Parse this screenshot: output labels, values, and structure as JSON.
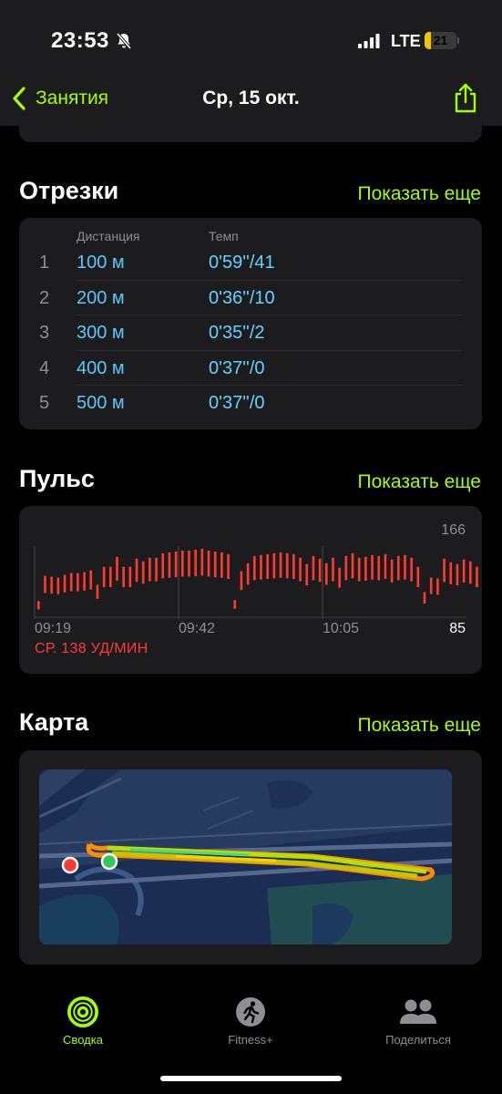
{
  "status": {
    "time": "23:53",
    "network": "LTE",
    "battery": "21",
    "battery_level": 0.21,
    "battery_color": "#f5c400"
  },
  "nav": {
    "back_label": "Занятия",
    "title": "Ср, 15 окт."
  },
  "splits": {
    "title": "Отрезки",
    "more": "Показать еще",
    "col_distance": "Дистанция",
    "col_pace": "Темп",
    "rows": [
      {
        "idx": "1",
        "distance": "100 м",
        "pace": "0'59''/41"
      },
      {
        "idx": "2",
        "distance": "200 м",
        "pace": "0'36''/10"
      },
      {
        "idx": "3",
        "distance": "300 м",
        "pace": "0'35''/2"
      },
      {
        "idx": "4",
        "distance": "400 м",
        "pace": "0'37''/0"
      },
      {
        "idx": "5",
        "distance": "500 м",
        "pace": "0'37''/0"
      }
    ]
  },
  "heart": {
    "title": "Пульс",
    "more": "Показать еще",
    "max": "166",
    "min": "85",
    "times": [
      "09:19",
      "09:42",
      "10:05"
    ],
    "avg": "СР. 138 УД/МИН",
    "color": "#ff3b30"
  },
  "chart_data": {
    "type": "bar",
    "ylim": [
      85,
      166
    ],
    "x_ticks": [
      "09:19",
      "09:42",
      "10:05"
    ],
    "bars_per_tick": 22,
    "series": [
      {
        "values": [
          103,
          131,
          130,
          129,
          132,
          134,
          134,
          135,
          137,
          121,
          141,
          141,
          152,
          141,
          141,
          150,
          147,
          151,
          151,
          156,
          157,
          158,
          159,
          159,
          160,
          161,
          159,
          158,
          157,
          155,
          104,
          136,
          145,
          153,
          154,
          155,
          156,
          157,
          156,
          155,
          151,
          144,
          153,
          150,
          145,
          151,
          140,
          153,
          156,
          151,
          152,
          154,
          153,
          155,
          149,
          153,
          154,
          151,
          141,
          113,
          129,
          128,
          150,
          146,
          144,
          149,
          147,
          141,
          148,
          140,
          140,
          134,
          116,
          107,
          104,
          103,
          103,
          102,
          103,
          101,
          103,
          101,
          102,
          104
        ]
      }
    ]
  },
  "map": {
    "title": "Карта",
    "more": "Показать еще"
  },
  "tabs": [
    {
      "label": "Сводка",
      "active": true
    },
    {
      "label": "Fitness+",
      "active": false
    },
    {
      "label": "Поделиться",
      "active": false
    }
  ]
}
